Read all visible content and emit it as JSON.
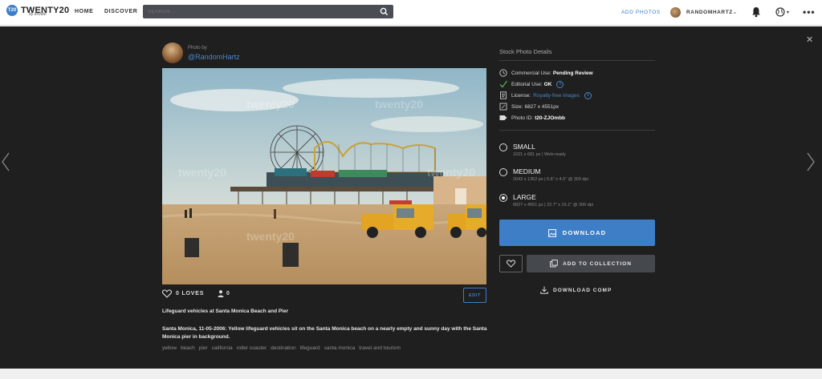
{
  "brand": {
    "mark": "T20",
    "name": "TWENTY20",
    "sub": "by envato"
  },
  "nav": {
    "home": "HOME",
    "discover": "DISCOVER"
  },
  "search": {
    "placeholder": "SEARCH..."
  },
  "header_right": {
    "add_photos": "ADD PHOTOS",
    "username": "RANDOMHARTZ"
  },
  "author": {
    "label": "Photo by",
    "name": "@RandomHartz"
  },
  "photo": {
    "watermark": "twenty20"
  },
  "stats": {
    "loves": "0 LOVES",
    "people": "0",
    "edit": "EDIT"
  },
  "caption": {
    "title": "Lifeguard vehicles at Santa Monica Beach and Pier",
    "description": "Santa Monica, 11-05-2006: Yellow lifeguard vehicles sit on the Santa Monica beach on a nearly empty and sunny day with the Santa Monica pier in background."
  },
  "tags": [
    "yellow",
    "beach",
    "pier",
    "california",
    "roller coaster",
    "destination",
    "lifeguard",
    "santa monica",
    "travel and tourism"
  ],
  "details": {
    "title": "Stock Photo Details",
    "commercial_label": "Commercial Use:",
    "commercial_value": "Pending Review",
    "editorial_label": "Editorial Use:",
    "editorial_value": "OK",
    "license_label": "License:",
    "license_value": "Royalty-free images",
    "size_label": "Size:",
    "size_value": "6827 x 4551px",
    "photo_id_label": "Photo ID:",
    "photo_id_value": "t20-ZJOmbb"
  },
  "sizes": [
    {
      "name": "SMALL",
      "meta": "1021 x 681 px  |  Web-ready",
      "selected": false
    },
    {
      "name": "MEDIUM",
      "meta": "2043 x 1362 px  |  6.8\" x 4.5\" @ 300 dpi",
      "selected": false
    },
    {
      "name": "LARGE",
      "meta": "6827 x 4551 px  |  22.7\" x 15.1\" @ 300 dpi",
      "selected": true
    }
  ],
  "actions": {
    "download": "DOWNLOAD",
    "add_to_collection": "ADD TO COLLECTION",
    "download_comp": "DOWNLOAD COMP"
  },
  "colors": {
    "accent": "#3d7ec7",
    "modal_bg": "#1f1f1f",
    "check": "#4caf50"
  }
}
